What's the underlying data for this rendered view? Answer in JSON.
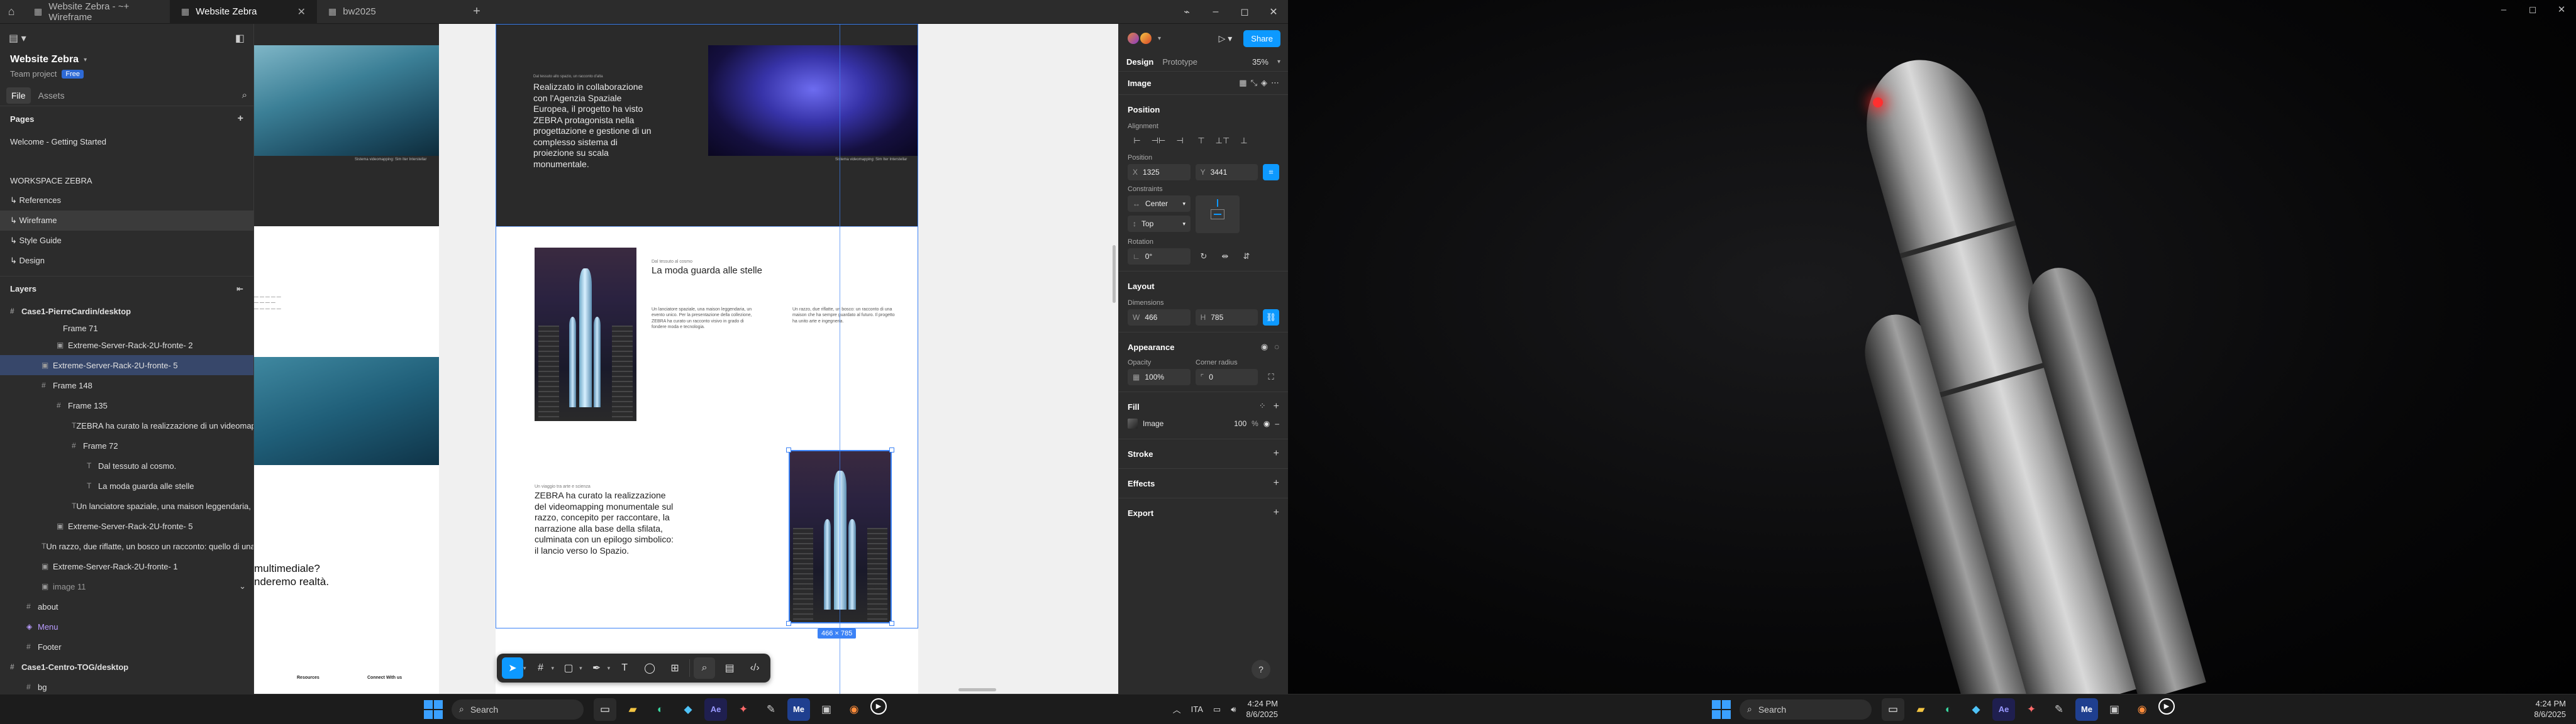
{
  "tabs": [
    {
      "label": "Website Zebra - ~+ Wireframe",
      "active": false
    },
    {
      "label": "Website Zebra",
      "active": true
    },
    {
      "label": "bw2025",
      "active": false
    }
  ],
  "project": {
    "name": "Website Zebra",
    "team": "Team project",
    "plan": "Free"
  },
  "left_tabs": {
    "file": "File",
    "assets": "Assets"
  },
  "pages": {
    "title": "Pages",
    "items": [
      {
        "label": "Welcome - Getting Started"
      },
      {
        "label": "WORKSPACE ZEBRA"
      },
      {
        "label": "↳ References"
      },
      {
        "label": "↳ Wireframe"
      },
      {
        "label": "↳ Style Guide"
      },
      {
        "label": "↳ Design"
      }
    ]
  },
  "layers": {
    "title": "Layers",
    "items": [
      {
        "label": "Case1-PierreCardin/desktop"
      },
      {
        "label": "Frame 71"
      },
      {
        "label": "Extreme-Server-Rack-2U-fronte- 2"
      },
      {
        "label": "Extreme-Server-Rack-2U-fronte- 5"
      },
      {
        "label": "Frame 148"
      },
      {
        "label": "Frame 135"
      },
      {
        "label": "ZEBRA ha curato la realizzazione di un videomapping monumentale..."
      },
      {
        "label": "Frame 72"
      },
      {
        "label": "Dal tessuto al cosmo."
      },
      {
        "label": "La moda guarda alle stelle"
      },
      {
        "label": "Un lanciatore spaziale, una maison leggendaria, Ru..."
      },
      {
        "label": "Extreme-Server-Rack-2U-fronte- 5"
      },
      {
        "label": "Un razzo, due riflatte, un bosco un racconto: quello di una maison..."
      },
      {
        "label": "Extreme-Server-Rack-2U-fronte- 1"
      },
      {
        "label": "image 11"
      },
      {
        "label": "about"
      },
      {
        "label": "Menu"
      },
      {
        "label": "Footer"
      },
      {
        "label": "Case1-Centro-TOG/desktop"
      },
      {
        "label": "bg"
      }
    ]
  },
  "canvas": {
    "heading1": "Realizzato in collaborazione con l'Agenzia Spaziale Europea, il progetto ha visto ZEBRA protagonista nella progettazione e gestione di un complesso sistema di proiezione su scala monumentale.",
    "eyebrow1": "Dal tessuto allo spazio, un racconto d'alta",
    "caption1": "Sistema videomapping: Sim Iter Interstellar",
    "caption2": "Sistema videomapping: Sim Iter Interstellar",
    "eyebrow2": "Dal tessuto al cosmo",
    "heading2": "La moda guarda alle stelle",
    "body1": "Un lanciatore spaziale, una maison leggendaria, un evento unico. Per la presentazione della collezione, ZEBRA ha curato un racconto visivo in grado di fondere moda e tecnologia.",
    "body2": "Un razzo, due riflatte, un bosco: un racconto di una maison che ha sempre guardato al futuro. Il progetto ha unito arte e ingegneria.",
    "eyebrow3": "Un viaggio tra arte e scienza",
    "heading3": "ZEBRA ha curato la realizzazione del videomapping monumentale sul razzo, concepito per raccontare, la narrazione alla base della sfilata, culminata con un epilogo simbolico: il lancio verso lo Spazio.",
    "side_heading": "multimediale? nderemo realtà.",
    "dim_label": "466 × 785",
    "footer_cols": [
      "Resources",
      "Connect With us"
    ]
  },
  "right_panel": {
    "share": "Share",
    "tabs": {
      "design": "Design",
      "prototype": "Prototype"
    },
    "zoom": "35%",
    "selection_type": "Image",
    "position": {
      "title": "Position",
      "alignment_label": "Alignment",
      "position_label": "Position",
      "x": "1325",
      "y": "3441",
      "constraints_label": "Constraints",
      "h_constraint": "Center",
      "v_constraint": "Top",
      "rotation_label": "Rotation",
      "rotation": "0°"
    },
    "layout": {
      "title": "Layout",
      "dimensions_label": "Dimensions",
      "w": "466",
      "h": "785"
    },
    "appearance": {
      "title": "Appearance",
      "opacity_label": "Opacity",
      "opacity": "100%",
      "radius_label": "Corner radius",
      "radius": "0"
    },
    "fill": {
      "title": "Fill",
      "type": "Image",
      "opacity": "100",
      "unit": "%"
    },
    "stroke": "Stroke",
    "effects": "Effects",
    "export": "Export",
    "help": "?"
  },
  "taskbar": {
    "search": "Search",
    "lang": "ITA",
    "time": "4:24 PM",
    "date": "8/6/2025"
  },
  "colors": {
    "accent": "#0d99ff",
    "selection": "#3b82f6",
    "panel": "#2c2c2c",
    "canvas_bg": "#f0f0f0"
  }
}
